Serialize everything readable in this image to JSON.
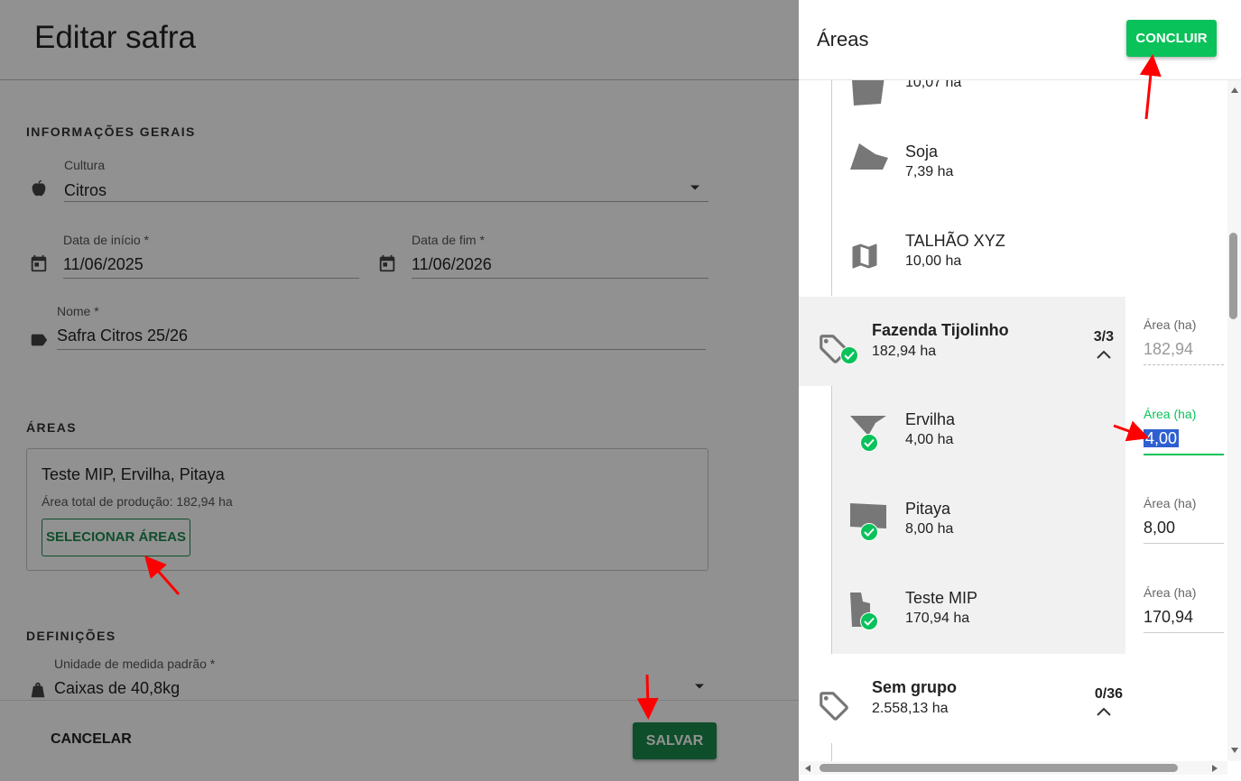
{
  "left": {
    "title": "Editar safra",
    "general": {
      "heading": "INFORMAÇÕES GERAIS",
      "culture_label": "Cultura",
      "culture_value": "Citros",
      "start_label": "Data de início *",
      "start_value": "11/06/2025",
      "end_label": "Data de fim *",
      "end_value": "11/06/2026",
      "name_label": "Nome *",
      "name_value": "Safra Citros 25/26"
    },
    "areas": {
      "heading": "ÁREAS",
      "selected": "Teste MIP, Ervilha, Pitaya",
      "total": "Área total de produção: 182,94 ha",
      "select_button": "SELECIONAR ÁREAS"
    },
    "definitions": {
      "heading": "DEFINIÇÕES",
      "unit_label": "Unidade de medida padrão *",
      "unit_value": "Caixas de 40,8kg"
    },
    "footer": {
      "cancel": "CANCELAR",
      "save": "SALVAR"
    }
  },
  "drawer": {
    "title": "Áreas",
    "confirm": "CONCLUIR",
    "top_items": [
      {
        "name": "",
        "ha": "10,07 ha"
      },
      {
        "name": "Soja",
        "ha": "7,39 ha"
      },
      {
        "name": "TALHÃO XYZ",
        "ha": "10,00 ha"
      }
    ],
    "groups": [
      {
        "name": "Fazenda Tijolinho",
        "ha": "182,94 ha",
        "count": "3/3",
        "area_label": "Área (ha)",
        "area_value": "182,94",
        "items": [
          {
            "name": "Ervilha",
            "ha": "4,00 ha",
            "area_label": "Área (ha)",
            "area_value": "4,00"
          },
          {
            "name": "Pitaya",
            "ha": "8,00 ha",
            "area_label": "Área (ha)",
            "area_value": "8,00"
          },
          {
            "name": "Teste MIP",
            "ha": "170,94 ha",
            "area_label": "Área (ha)",
            "area_value": "170,94"
          }
        ]
      },
      {
        "name": "Sem grupo",
        "ha": "2.558,13 ha",
        "count": "0/36"
      }
    ]
  },
  "colors": {
    "primary": "#1b8a4d",
    "accent": "#0ac25a",
    "annotation_arrow": "#ff0000"
  }
}
